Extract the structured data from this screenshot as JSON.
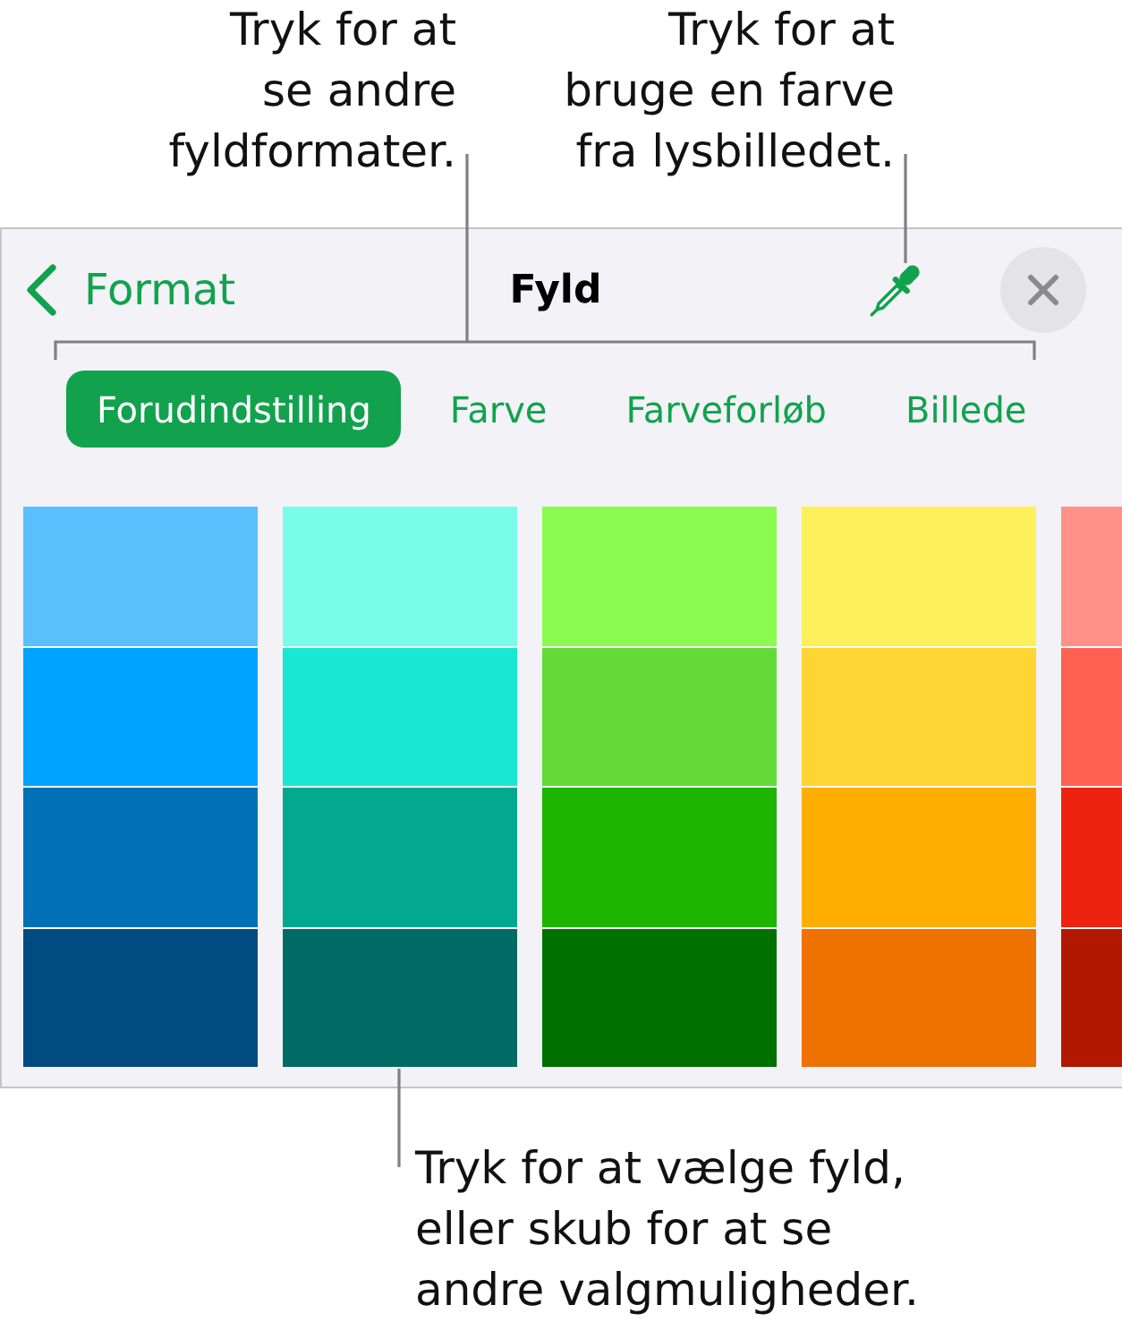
{
  "callouts_top": [
    {
      "lines": [
        "Tryk for at",
        "se andre",
        "fyldformater."
      ]
    },
    {
      "lines": [
        "Tryk for at",
        "bruge en farve",
        "fra lysbilledet."
      ]
    }
  ],
  "panel": {
    "back_button": {
      "label": "Format"
    },
    "title": "Fyld",
    "tabs": [
      {
        "label": "Forudindstilling",
        "selected": true
      },
      {
        "label": "Farve",
        "selected": false
      },
      {
        "label": "Farveforløb",
        "selected": false
      },
      {
        "label": "Billede",
        "selected": false
      }
    ],
    "swatch_columns": [
      {
        "swatches": [
          {
            "color": "#5ac0fd"
          },
          {
            "color": "#00a3fe"
          },
          {
            "color": "#0071b7"
          },
          {
            "color": "#004c80"
          }
        ]
      },
      {
        "swatches": [
          {
            "color": "#79fde9"
          },
          {
            "color": "#18e7d3"
          },
          {
            "color": "#02a98f"
          },
          {
            "color": "#006b65"
          }
        ]
      },
      {
        "swatches": [
          {
            "color": "#8cfb4f"
          },
          {
            "color": "#63da38"
          },
          {
            "color": "#1eb500"
          },
          {
            "color": "#007100"
          }
        ]
      },
      {
        "swatches": [
          {
            "color": "#fef05a"
          },
          {
            "color": "#fed533"
          },
          {
            "color": "#feae00"
          },
          {
            "color": "#ef7100"
          }
        ]
      },
      {
        "swatches": [
          {
            "color": "#ff9189"
          },
          {
            "color": "#ff6150"
          },
          {
            "color": "#ed2310"
          },
          {
            "color": "#b21800"
          }
        ]
      }
    ]
  },
  "callout_bottom": {
    "lines": [
      "Tryk for at vælge fyld,",
      "eller skub for at se",
      "andre valgmuligheder."
    ]
  }
}
